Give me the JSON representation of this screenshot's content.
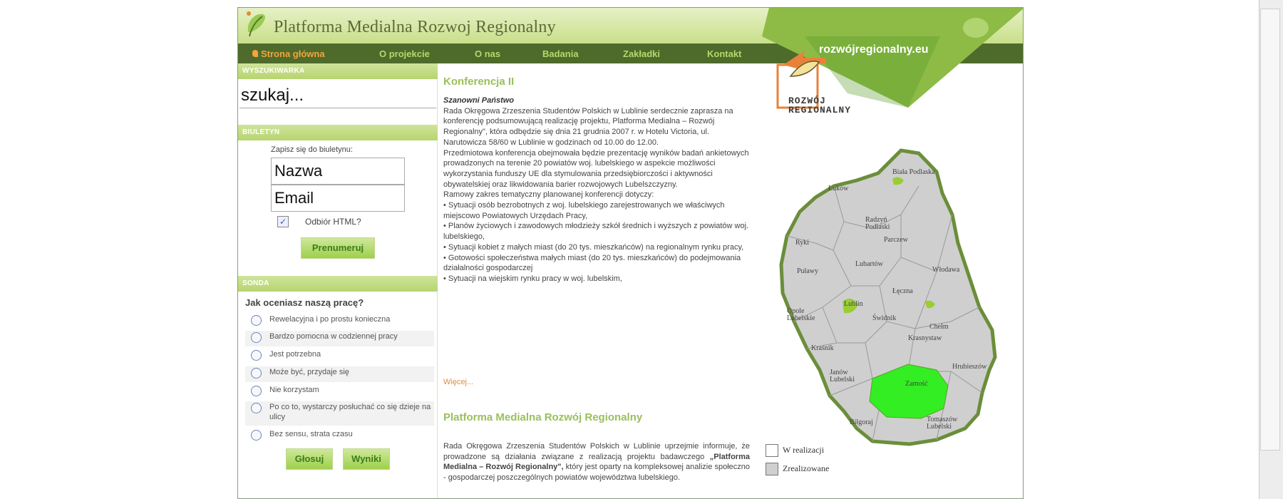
{
  "header": {
    "title": "Platforma Medialna Rozwoj Regionalny",
    "banner_url": "rozwójregionalny.eu",
    "banner_logo_text": "ROZWÓJ\nREGIONALNY"
  },
  "nav": {
    "items": [
      {
        "label": "Strona główna",
        "active": true
      },
      {
        "label": "O projekcie",
        "active": false
      },
      {
        "label": "O nas",
        "active": false
      },
      {
        "label": "Badania",
        "active": false
      },
      {
        "label": "Zakładki",
        "active": false
      },
      {
        "label": "Kontakt",
        "active": false
      }
    ]
  },
  "search": {
    "heading": "WYSZUKIWARKA",
    "value": "szukaj..."
  },
  "newsletter": {
    "heading": "BIULETYN",
    "label": "Zapisz się do biuletynu:",
    "name_value": "Nazwa",
    "email_value": "Email",
    "html_checked": true,
    "html_label": "Odbiór HTML?",
    "subscribe_label": "Prenumeruj"
  },
  "poll": {
    "heading": "SONDA",
    "question": "Jak oceniasz naszą pracę?",
    "options": [
      "Rewelacyjna i po prostu konieczna",
      "Bardzo pomocna w codziennej pracy",
      "Jest potrzebna",
      "Może być, przydaje się",
      "Nie korzystam",
      "Po co to, wystarczy posłuchać co się dzieje na ulicy",
      "Bez sensu, strata czasu"
    ],
    "vote_label": "Głosuj",
    "results_label": "Wyniki"
  },
  "article1": {
    "title": "Konferencja II",
    "greeting": "Szanowni Państwo",
    "paragraphs": [
      "Rada Okręgowa Zrzeszenia Studentów Polskich w Lublinie serdecznie zaprasza na konferencję podsumowującą realizację projektu, Platforma Medialna – Rozwój Regionalny\", która odbędzie się dnia 21 grudnia 2007 r. w Hotelu Victoria, ul. Narutowicza 58/60 w Lublinie w godzinach od 10.00 do 12.00.",
      "Przedmiotowa konferencja obejmowała będzie prezentację wyników badań ankietowych prowadzonych na terenie 20 powiatów woj. lubelskiego w aspekcie możliwości wykorzystania funduszy UE dla stymulowania przedsiębiorczości i aktywności obywatelskiej oraz likwidowania barier rozwojowych Lubelszczyzny.",
      "Ramowy zakres tematyczny planowanej konferencji dotyczy:",
      "• Sytuacji osób bezrobotnych z woj. lubelskiego zarejestrowanych we właściwych miejscowo Powiatowych Urzędach Pracy,",
      "• Planów życiowych i zawodowych młodzieży szkół średnich i wyższych z powiatów woj. lubelskiego,",
      "• Sytuacji kobiet z małych miast (do 20 tys. mieszkańców) na regionalnym rynku pracy,",
      "• Gotowości społeczeństwa małych miast (do 20 tys. mieszkańców) do podejmowania działalności gospodarczej",
      "• Sytuacji na wiejskim rynku pracy w woj. lubelskim,"
    ],
    "more_label": "Więcej..."
  },
  "article2": {
    "title": "Platforma Medialna  Rozwój Regionalny",
    "text_before": "Rada Okręgowa Zrzeszenia Studentów Polskich w Lublinie uprzejmie informuje, że prowadzone są działania związane z realizacją projektu badawczego ",
    "text_bold": "„Platforma Medialna – Rozwój Regionalny\",",
    "text_after": " który jest oparty na kompleksowej analizie społeczno - gospodarczej poszczególnych powiatów województwa lubelskiego."
  },
  "map": {
    "districts": [
      "Biała Podlaska",
      "Łuków",
      "Radzyń Podlaski",
      "Parczew",
      "Ryki",
      "Lubartów",
      "Włodawa",
      "Puławy",
      "Łęczna",
      "Lublin",
      "Świdnik",
      "Opole Lubelskie",
      "Chełm",
      "Krasnystaw",
      "Kraśnik",
      "Hrubieszów",
      "Janów Lubelski",
      "Zamość",
      "Biłgoraj",
      "Tomaszów Lubelski"
    ]
  },
  "legend": {
    "in_progress": "W realizacji",
    "done": "Zrealizowane"
  },
  "colors": {
    "nav_bg": "#4e6b2c",
    "accent_green": "#9ac05a",
    "active_orange": "#f3a43a",
    "map_highlight": "#33ee22",
    "map_partial": "#9acd32"
  }
}
